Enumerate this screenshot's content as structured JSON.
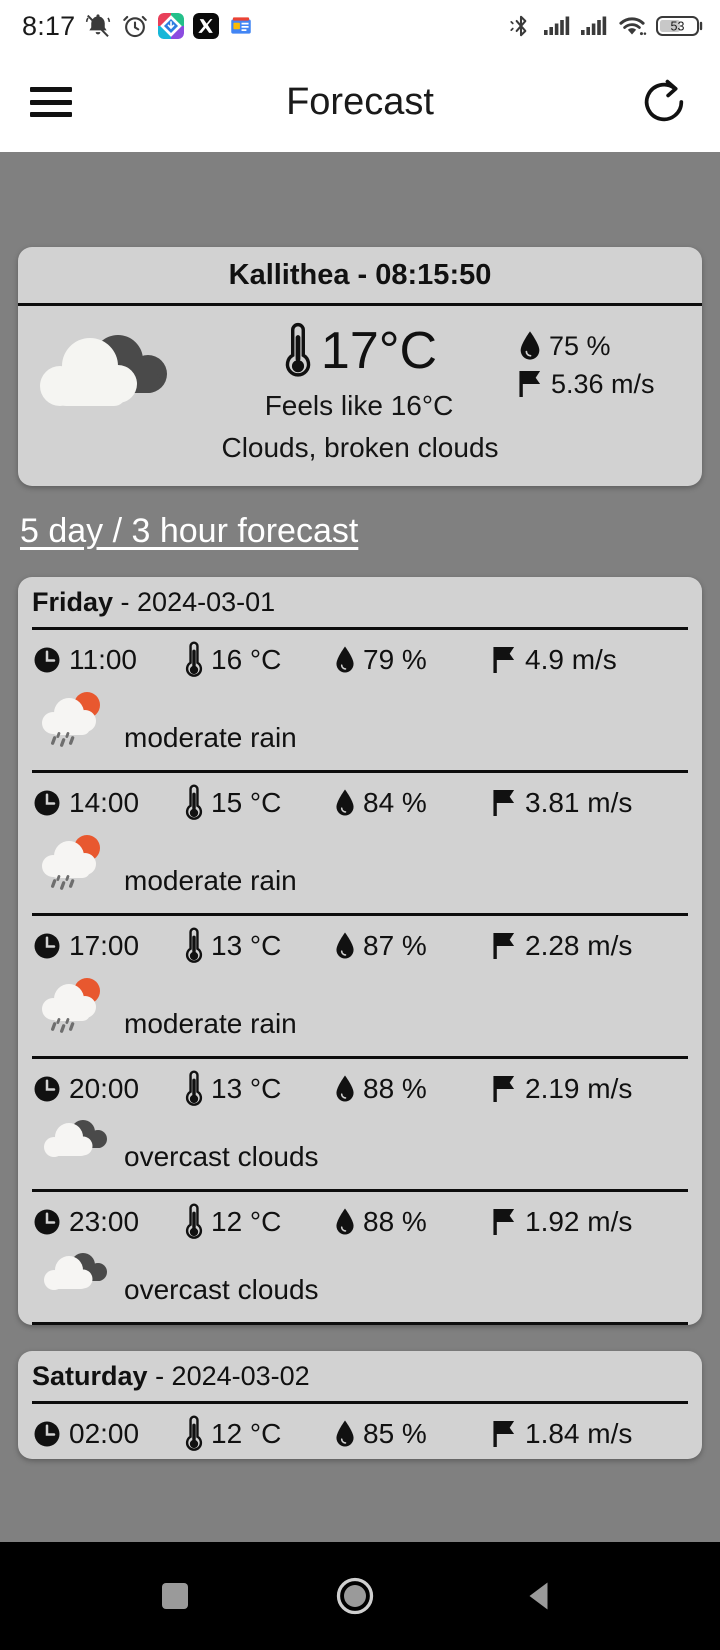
{
  "status_bar": {
    "time": "8:17",
    "battery_percent": "53",
    "icons": [
      "bell-muted-icon",
      "alarm-clock-icon",
      "photo-app-icon",
      "x-app-icon",
      "news-app-icon",
      "bluetooth-icon",
      "signal-bars-icon",
      "signal-bars-2-icon",
      "wifi-icon",
      "battery-icon"
    ]
  },
  "app_bar": {
    "title": "Forecast",
    "menu_icon": "hamburger-menu-icon",
    "refresh_icon": "refresh-icon"
  },
  "current": {
    "header": "Kallithea - 08:15:50",
    "location": "Kallithea",
    "observation_time": "08:15:50",
    "temperature": "17°C",
    "feels_like": "Feels like 16°C",
    "humidity": "75 %",
    "wind": "5.36 m/s",
    "description": "Clouds, broken clouds",
    "icon": "broken-clouds-icon"
  },
  "forecast_heading": "5 day / 3 hour forecast",
  "days": [
    {
      "day_name": "Friday",
      "date": "- 2024-03-01",
      "slots": [
        {
          "time": "11:00",
          "temp": "16 °C",
          "humidity": "79 %",
          "wind": "4.9 m/s",
          "desc": "moderate rain",
          "icon": "rain-sun-icon"
        },
        {
          "time": "14:00",
          "temp": "15 °C",
          "humidity": "84 %",
          "wind": "3.81 m/s",
          "desc": "moderate rain",
          "icon": "rain-sun-icon"
        },
        {
          "time": "17:00",
          "temp": "13 °C",
          "humidity": "87 %",
          "wind": "2.28 m/s",
          "desc": "moderate rain",
          "icon": "rain-sun-icon"
        },
        {
          "time": "20:00",
          "temp": "13 °C",
          "humidity": "88 %",
          "wind": "2.19 m/s",
          "desc": "overcast clouds",
          "icon": "overcast-clouds-icon"
        },
        {
          "time": "23:00",
          "temp": "12 °C",
          "humidity": "88 %",
          "wind": "1.92 m/s",
          "desc": "overcast clouds",
          "icon": "overcast-clouds-icon"
        }
      ]
    },
    {
      "day_name": "Saturday",
      "date": "- 2024-03-02",
      "slots": [
        {
          "time": "02:00",
          "temp": "12 °C",
          "humidity": "85 %",
          "wind": "1.84 m/s",
          "desc": "",
          "icon": ""
        }
      ]
    }
  ],
  "nav_bar": {
    "recents_icon": "square-recents-icon",
    "home_icon": "circle-home-icon",
    "back_icon": "triangle-back-icon"
  },
  "colors": {
    "page_background": "#808080",
    "card_background": "#d2d2d2",
    "app_bar_background": "#ffffff",
    "nav_bar_background": "#000000",
    "accent_sun": "#e8582f",
    "text_primary": "#111111",
    "heading_text": "#ffffff"
  }
}
